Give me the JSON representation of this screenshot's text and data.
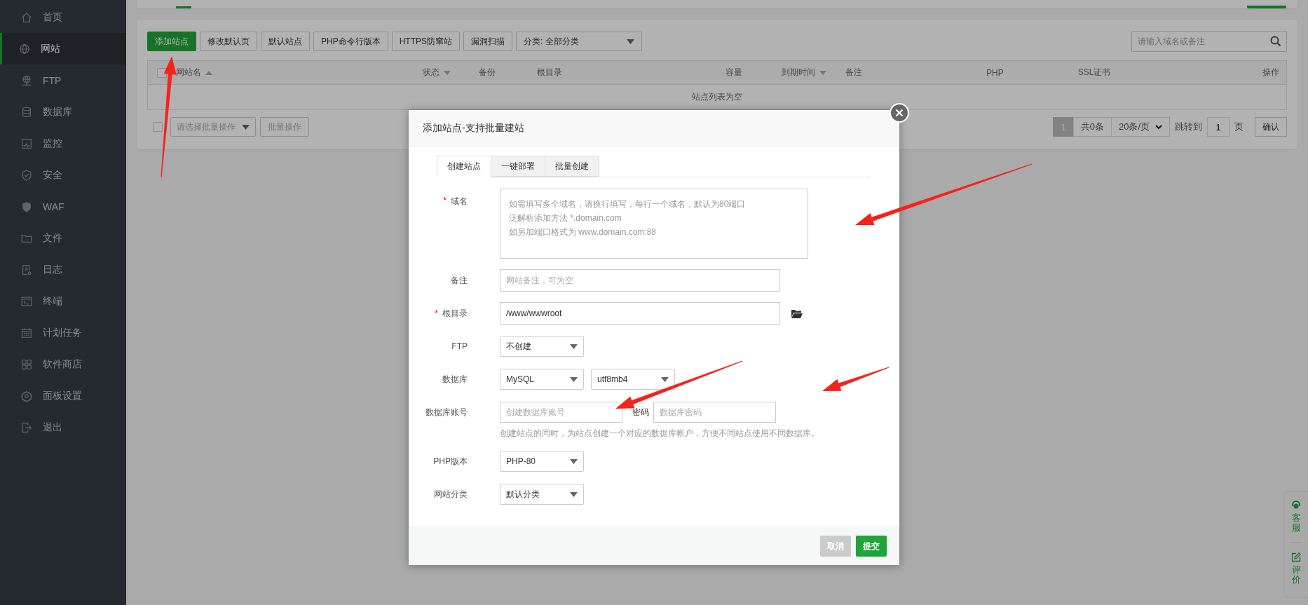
{
  "sidebar": {
    "items": [
      {
        "label": "首页",
        "selected": false
      },
      {
        "label": "网站",
        "selected": true
      },
      {
        "label": "FTP",
        "selected": false
      },
      {
        "label": "数据库",
        "selected": false
      },
      {
        "label": "监控",
        "selected": false
      },
      {
        "label": "安全",
        "selected": false
      },
      {
        "label": "WAF",
        "selected": false
      },
      {
        "label": "文件",
        "selected": false
      },
      {
        "label": "日志",
        "selected": false
      },
      {
        "label": "终端",
        "selected": false
      },
      {
        "label": "计划任务",
        "selected": false
      },
      {
        "label": "软件商店",
        "selected": false
      },
      {
        "label": "面板设置",
        "selected": false
      },
      {
        "label": "退出",
        "selected": false
      }
    ]
  },
  "site_list": {
    "toolbar": {
      "buttons": [
        {
          "label": "添加站点",
          "kind": "primary"
        },
        {
          "label": "修改默认页",
          "kind": "default"
        },
        {
          "label": "默认站点",
          "kind": "default"
        },
        {
          "label": "PHP命令行版本",
          "kind": "default"
        },
        {
          "label": "HTTPS防窜站",
          "kind": "default"
        },
        {
          "label": "漏洞扫描",
          "kind": "default"
        }
      ],
      "category_select": {
        "value": "分类: 全部分类"
      },
      "search": {
        "placeholder": "请输入域名或备注"
      }
    },
    "table": {
      "select_all": {
        "checked": false
      },
      "columns": [
        {
          "label": "网站名",
          "sortable": true,
          "descending": false
        },
        {
          "label": "状态",
          "sortable": true,
          "descending": true
        },
        {
          "label": "备份",
          "sortable": false
        },
        {
          "label": "根目录",
          "sortable": false
        },
        {
          "label": "容量",
          "sortable": false
        },
        {
          "label": "到期时间",
          "sortable": true,
          "descending": true
        },
        {
          "label": "备注",
          "sortable": false
        },
        {
          "label": "PHP",
          "sortable": false
        },
        {
          "label": "SSL证书",
          "sortable": false
        },
        {
          "label": "操作",
          "sortable": false
        }
      ],
      "empty_text": "站点列表为空"
    },
    "footer": {
      "bulk_select": {
        "checked": false
      },
      "bulk_action": {
        "placeholder": "请选择批量操作"
      },
      "bulk_button": {
        "label": "批量操作",
        "disabled": true
      },
      "pagination": {
        "pages": [
          {
            "label": "1",
            "selected": true
          }
        ],
        "total": "共0条",
        "page_size": "20条/页",
        "jump_label": "跳转到",
        "jump_value": "1",
        "page_unit": "页",
        "confirm": "确认"
      }
    }
  },
  "modal": {
    "title": "添加站点-支持批量建站",
    "required_mark": "*",
    "tabs": [
      {
        "label": "创建站点",
        "selected": true
      },
      {
        "label": "一键部署",
        "selected": false
      },
      {
        "label": "批量创建",
        "selected": false
      }
    ],
    "fields": [
      {
        "kind": "textarea",
        "label": "域名",
        "required": true,
        "placeholder_lines": [
          "如需填写多个域名，请换行填写，每行一个域名，默认为80端口",
          "泛解析添加方法 *.domain.com",
          "如另加端口格式为 www.domain.com:88"
        ]
      },
      {
        "kind": "input",
        "label": "备注",
        "required": false,
        "placeholder": "网站备注，可为空"
      },
      {
        "kind": "path",
        "label": "根目录",
        "required": true,
        "value": "/www/wwwroot"
      },
      {
        "kind": "select",
        "label": "FTP",
        "required": false,
        "values": [
          "不创建"
        ]
      },
      {
        "kind": "select",
        "label": "数据库",
        "required": false,
        "values": [
          "MySQL",
          "utf8mb4"
        ]
      },
      {
        "kind": "account",
        "label": "数据库账号",
        "required": false,
        "placeholder": "创建数据库账号",
        "second_label": "密码",
        "second_placeholder": "数据库密码",
        "hint": "创建站点的同时，为站点创建一个对应的数据库帐户，方便不同站点使用不同数据库。"
      },
      {
        "kind": "select",
        "label": "PHP版本",
        "required": false,
        "values": [
          "PHP-80"
        ]
      },
      {
        "kind": "select",
        "label": "网站分类",
        "required": false,
        "values": [
          "默认分类"
        ]
      }
    ],
    "buttons": [
      {
        "label": "取消",
        "kind": "cancel"
      },
      {
        "label": "提交",
        "kind": "submit"
      }
    ]
  },
  "float_widget": {
    "items": [
      {
        "label": "客服",
        "kind": "support"
      },
      {
        "label": "评价",
        "kind": "review"
      }
    ]
  }
}
